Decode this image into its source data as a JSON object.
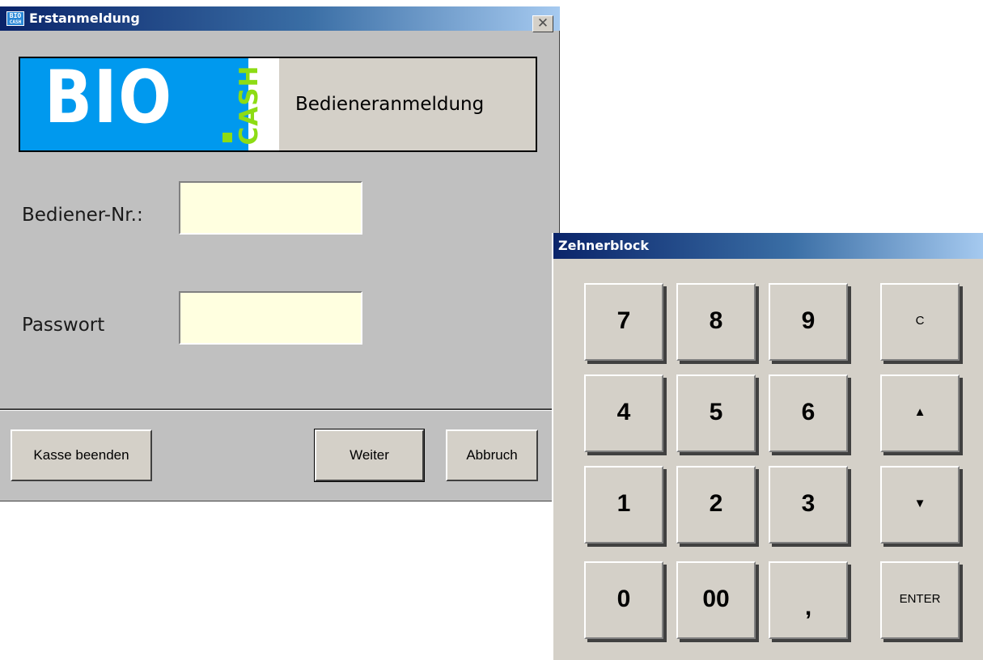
{
  "login_window": {
    "title": "Erstanmeldung",
    "icon_top": "BIO",
    "icon_bottom": "CASH",
    "close_glyph": "✕",
    "banner": {
      "logo_text": "BIO",
      "logo_sub": "CASH",
      "heading": "Bedieneranmeldung"
    },
    "fields": {
      "operator_label": "Bediener-Nr.:",
      "operator_value": "",
      "password_label": "Passwort",
      "password_value": ""
    },
    "buttons": {
      "exit": "Kasse beenden",
      "next": "Weiter",
      "cancel": "Abbruch"
    }
  },
  "keypad_window": {
    "title": "Zehnerblock",
    "keys": {
      "k7": "7",
      "k8": "8",
      "k9": "9",
      "clear": "C",
      "k4": "4",
      "k5": "5",
      "k6": "6",
      "up": "▲",
      "k1": "1",
      "k2": "2",
      "k3": "3",
      "down": "▼",
      "k0": "0",
      "k00": "00",
      "comma": ",",
      "enter": "ENTER"
    }
  },
  "colors": {
    "titlebar_start": "#0a246a",
    "titlebar_end": "#a6caf0",
    "logo_blue": "#0099ee",
    "logo_green": "#8ddc14",
    "input_bg": "#ffffe0",
    "window_bg": "#c0c0c0"
  }
}
